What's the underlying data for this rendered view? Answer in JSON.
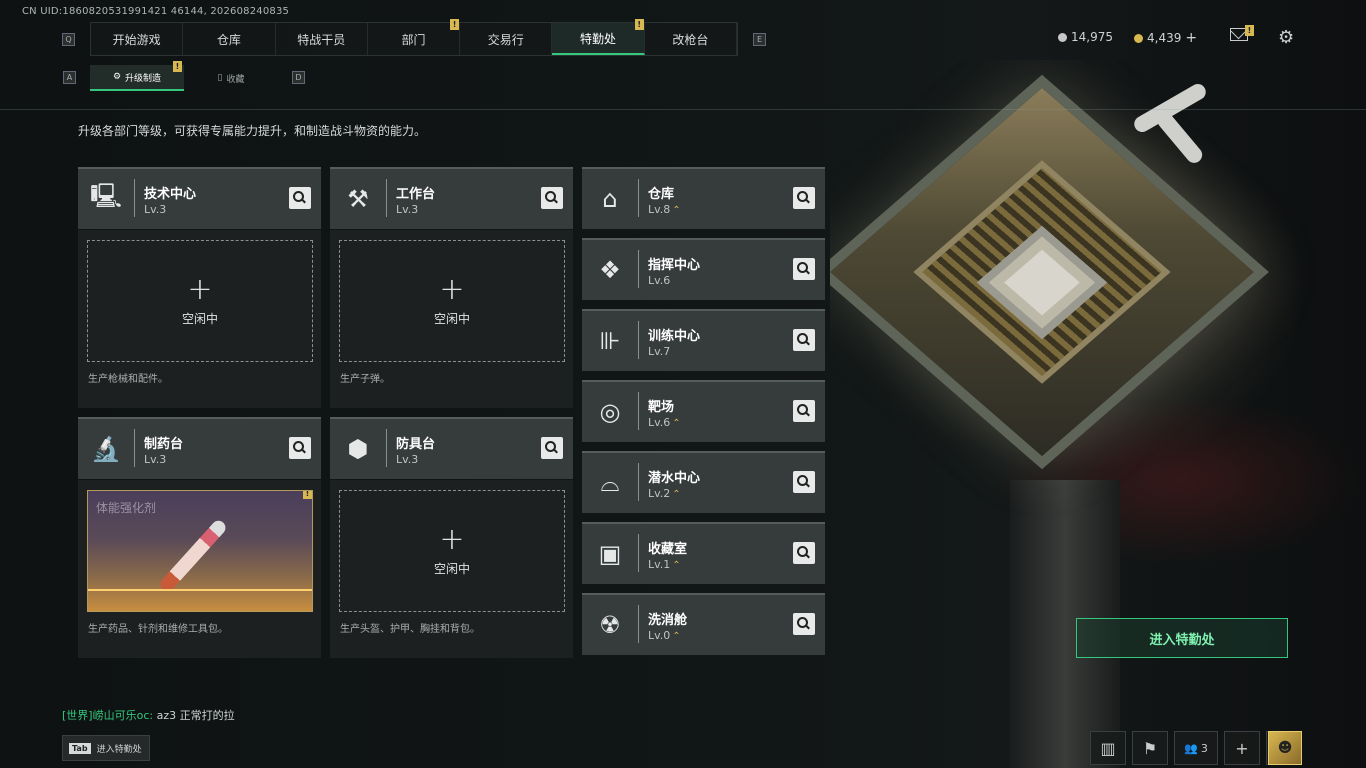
{
  "uid": "CN UID:1860820531991421 46144, 202608240835",
  "nav": {
    "tabs": [
      {
        "label": "开始游戏"
      },
      {
        "label": "仓库"
      },
      {
        "label": "特战干员"
      },
      {
        "label": "部门"
      },
      {
        "label": "交易行"
      },
      {
        "label": "特勤处",
        "active": true
      },
      {
        "label": "改枪台"
      }
    ],
    "left_key": "Q",
    "right_key": "E"
  },
  "currency": {
    "silver": "14,975",
    "gold": "4,439",
    "add": "+"
  },
  "subtabs": [
    {
      "label": "升级制造",
      "active": true
    },
    {
      "label": "收藏"
    }
  ],
  "sub_left_key": "A",
  "sub_right_key": "D",
  "description": "升级各部门等级，可获得专属能力提升，和制造战斗物资的能力。",
  "workshops": [
    {
      "name": "技术中心",
      "level": "Lv.3",
      "icon": "computer-icon",
      "state": "空闲中",
      "desc": "生产枪械和配件。"
    },
    {
      "name": "工作台",
      "level": "Lv.3",
      "icon": "tools-icon",
      "state": "空闲中",
      "desc": "生产子弹。"
    },
    {
      "name": "制药台",
      "level": "Lv.3",
      "icon": "microscope-icon",
      "item": "体能强化剂",
      "desc": "生产药品、针剂和维修工具包。"
    },
    {
      "name": "防具台",
      "level": "Lv.3",
      "icon": "armor-blocks-icon",
      "state": "空闲中",
      "desc": "生产头盔、护甲、胸挂和背包。"
    }
  ],
  "departments": [
    {
      "name": "仓库",
      "level": "Lv.8",
      "upgrade": true,
      "icon": "warehouse-icon"
    },
    {
      "name": "指挥中心",
      "level": "Lv.6",
      "upgrade": false,
      "icon": "command-chip-icon"
    },
    {
      "name": "训练中心",
      "level": "Lv.7",
      "upgrade": false,
      "icon": "dumbbell-icon"
    },
    {
      "name": "靶场",
      "level": "Lv.6",
      "upgrade": true,
      "icon": "target-icon"
    },
    {
      "name": "潜水中心",
      "level": "Lv.2",
      "upgrade": true,
      "icon": "diving-mask-icon"
    },
    {
      "name": "收藏室",
      "level": "Lv.1",
      "upgrade": true,
      "icon": "display-case-icon"
    },
    {
      "name": "洗消舱",
      "level": "Lv.0",
      "upgrade": true,
      "icon": "radiation-icon"
    }
  ],
  "enter_button": "进入特勤处",
  "chat": {
    "channel": "[世界]",
    "user": "崂山可乐oc:",
    "message": " az3 正常打的拉"
  },
  "tab_hint": {
    "key": "Tab",
    "label": "进入特勤处"
  },
  "bottom": {
    "friends_count": "3"
  },
  "colors": {
    "accent": "#35c77e",
    "badge": "#d8b850",
    "upgrade": "#d6b45c"
  }
}
